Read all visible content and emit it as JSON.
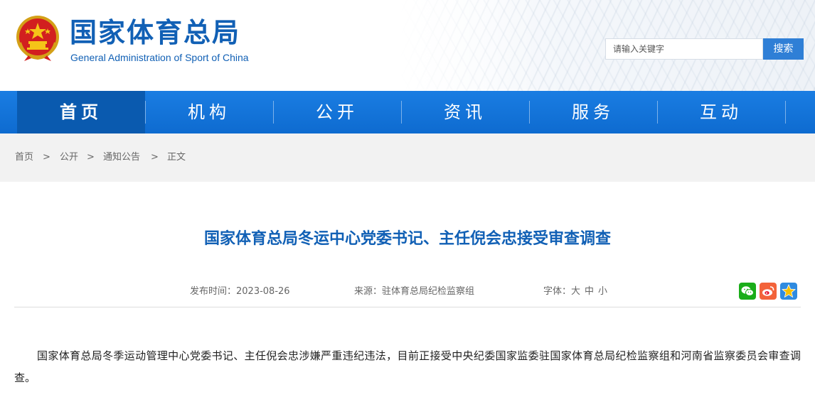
{
  "header": {
    "title": "国家体育总局",
    "subtitle": "General Administration of Sport of China",
    "emblem_icon": "national-emblem-icon"
  },
  "search": {
    "placeholder": "请输入关键字",
    "button_label": "搜索"
  },
  "nav": {
    "items": [
      {
        "label": "首页",
        "active": true
      },
      {
        "label": "机构",
        "active": false
      },
      {
        "label": "公开",
        "active": false
      },
      {
        "label": "资讯",
        "active": false
      },
      {
        "label": "服务",
        "active": false
      },
      {
        "label": "互动",
        "active": false
      }
    ]
  },
  "breadcrumb": {
    "items": [
      "首页",
      "公开",
      "通知公告",
      "正文"
    ],
    "separator": ">"
  },
  "article": {
    "title": "国家体育总局冬运中心党委书记、主任倪会忠接受审查调查",
    "publish_label": "发布时间：",
    "publish_date": "2023-08-26",
    "source_label": "来源：",
    "source": "驻体育总局纪检监察组",
    "font_label": "字体：",
    "font_sizes": [
      "大",
      "中",
      "小"
    ],
    "share_icons": [
      "wechat-icon",
      "weibo-icon",
      "qzone-icon"
    ],
    "body": "国家体育总局冬季运动管理中心党委书记、主任倪会忠涉嫌严重违纪违法，目前正接受中央纪委国家监委驻国家体育总局纪检监察组和河南省监察委员会审查调查。"
  },
  "colors": {
    "brand_blue": "#1160b5",
    "nav_blue": "#1a7de2",
    "nav_active": "#0a5aaf",
    "search_button": "#2f7fd6",
    "wechat_green": "#1aad19",
    "weibo_red": "#e6162d",
    "qzone_yellow": "#f6c000"
  }
}
